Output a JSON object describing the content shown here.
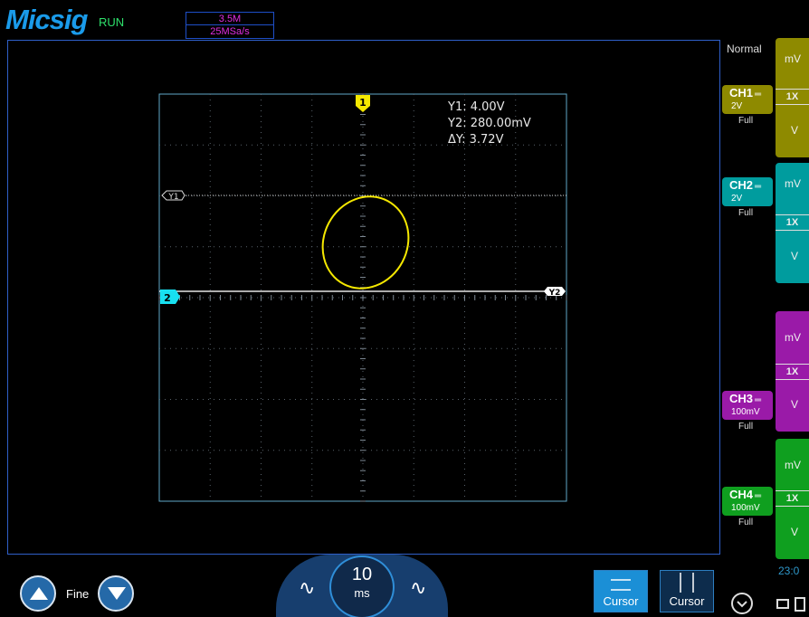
{
  "header": {
    "logo": "Micsig",
    "run_status": "RUN",
    "memory_depth": "3.5M",
    "sample_rate": "25MSa/s"
  },
  "measurements": {
    "y1": "Y1: 4.00V",
    "y2": "Y2: 280.00mV",
    "delta_y": "ΔY: 3.72V"
  },
  "markers": {
    "ch1": "1",
    "ch2": "2",
    "cursor_y1": "Y1",
    "cursor_y2": "Y2"
  },
  "right_panel": {
    "trigger_mode": "Normal",
    "channels": [
      {
        "name": "CH1",
        "scale": "2V",
        "bandwidth": "Full",
        "color": "#8e8a00"
      },
      {
        "name": "CH2",
        "scale": "2V",
        "bandwidth": "Full",
        "color": "#009c9e"
      },
      {
        "name": "CH3",
        "scale": "100mV",
        "bandwidth": "Full",
        "color": "#9a1aa8"
      },
      {
        "name": "CH4",
        "scale": "100mV",
        "bandwidth": "Full",
        "color": "#0f9f1f"
      }
    ],
    "side_panels": [
      {
        "unit_top": "mV",
        "probe": "1X",
        "unit_bottom": "V",
        "color": "#8e8a00"
      },
      {
        "unit_top": "mV",
        "probe": "1X",
        "unit_bottom": "V",
        "color": "#009c9e"
      },
      {
        "unit_top": "mV",
        "probe": "1X",
        "unit_bottom": "V",
        "color": "#9a1aa8"
      },
      {
        "unit_top": "mV",
        "probe": "1X",
        "unit_bottom": "V",
        "color": "#0f9f1f"
      }
    ],
    "clock": "23:0"
  },
  "bottom_bar": {
    "fine_label": "Fine",
    "timebase_value": "10",
    "timebase_unit": "ms",
    "cursor_horizontal_label": "Cursor",
    "cursor_vertical_label": "Cursor"
  },
  "colors": {
    "ch1": "#f5e800",
    "ch2": "#18e0f0",
    "grid": "#6f7a85",
    "frame": "#2f5fc8"
  }
}
